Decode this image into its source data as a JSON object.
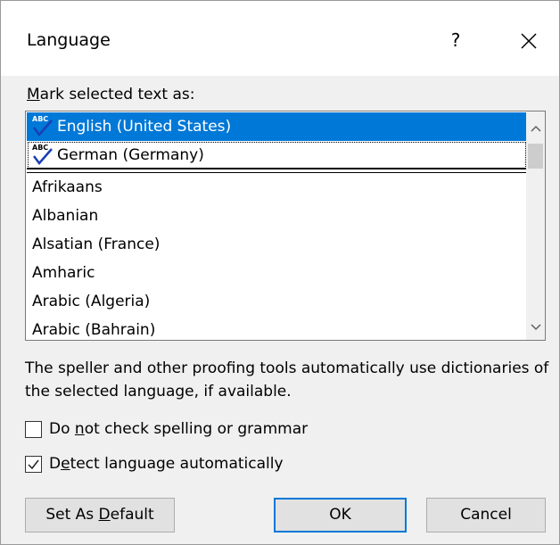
{
  "dialog": {
    "title": "Language",
    "help": "?",
    "close_icon": "close-icon"
  },
  "list": {
    "label_access_key": "M",
    "label_rest": "ark selected text as:",
    "items": [
      {
        "label": "English (United States)",
        "proofing": true,
        "selected": true
      },
      {
        "label": "German (Germany)",
        "proofing": true,
        "selected": false
      },
      {
        "label": "Afrikaans",
        "proofing": false,
        "selected": false
      },
      {
        "label": "Albanian",
        "proofing": false,
        "selected": false
      },
      {
        "label": "Alsatian (France)",
        "proofing": false,
        "selected": false
      },
      {
        "label": "Amharic",
        "proofing": false,
        "selected": false
      },
      {
        "label": "Arabic (Algeria)",
        "proofing": false,
        "selected": false
      },
      {
        "label": "Arabic (Bahrain)",
        "proofing": false,
        "selected": false
      }
    ],
    "abc_text": "ABC"
  },
  "description": "The speller and other proofing tools automatically use dictionaries of the selected language, if available.",
  "options": {
    "no_check": {
      "pre": "Do ",
      "key": "n",
      "post": "ot check spelling or grammar",
      "checked": false
    },
    "detect": {
      "pre": "D",
      "key": "e",
      "post": "tect language automatically",
      "checked": true
    }
  },
  "buttons": {
    "set_default": {
      "pre": "Set As ",
      "key": "D",
      "post": "efault"
    },
    "ok": "OK",
    "cancel": "Cancel"
  },
  "colors": {
    "selection": "#0078d7",
    "check_blue": "#1a3fb5"
  }
}
